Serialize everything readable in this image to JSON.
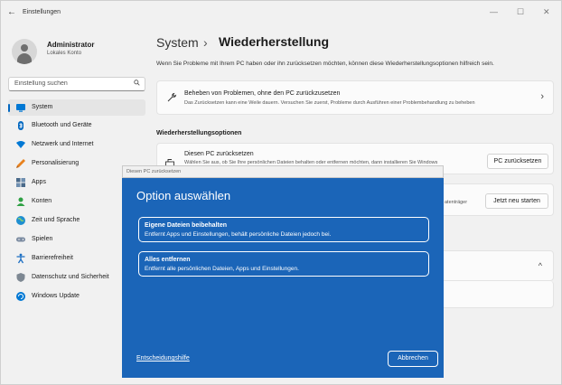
{
  "window": {
    "title": "Einstellungen",
    "back": "←",
    "min": "—",
    "max": "☐",
    "close": "✕"
  },
  "user": {
    "name": "Administrator",
    "role": "Lokales Konto"
  },
  "search": {
    "placeholder": "Einstellung suchen",
    "icon": "search-icon"
  },
  "sidebar": {
    "items": [
      {
        "label": "System",
        "icon": "system-icon",
        "color": "#0078d4"
      },
      {
        "label": "Bluetooth und Geräte",
        "icon": "bluetooth-icon",
        "color": "#0067c0"
      },
      {
        "label": "Netzwerk und Internet",
        "icon": "network-icon",
        "color": "#0078d4"
      },
      {
        "label": "Personalisierung",
        "icon": "brush-icon",
        "color": "#e8821e"
      },
      {
        "label": "Apps",
        "icon": "apps-icon",
        "color": "#4a6a8a"
      },
      {
        "label": "Konten",
        "icon": "accounts-icon",
        "color": "#2ea043"
      },
      {
        "label": "Zeit und Sprache",
        "icon": "globe-icon",
        "color": "#1f8fd0"
      },
      {
        "label": "Spielen",
        "icon": "gamepad-icon",
        "color": "#7a8aa0"
      },
      {
        "label": "Barrierefreiheit",
        "icon": "accessibility-icon",
        "color": "#1b6ec2"
      },
      {
        "label": "Datenschutz und Sicherheit",
        "icon": "shield-icon",
        "color": "#7d8792"
      },
      {
        "label": "Windows Update",
        "icon": "update-icon",
        "color": "#0078d4"
      }
    ]
  },
  "main": {
    "breadcrumb_parent": "System",
    "breadcrumb_sep": "›",
    "breadcrumb_current": "Wiederherstellung",
    "intro": "Wenn Sie Probleme mit Ihrem PC haben oder ihn zurücksetzen möchten, können diese Wiederherstellungsoptionen hilfreich sein.",
    "fix_card": {
      "title": "Beheben von Problemen, ohne den PC zurückzusetzen",
      "subtitle": "Das Zurücksetzen kann eine Weile dauern. Versuchen Sie zuerst, Probleme durch Ausführen einer Problembehandlung zu beheben",
      "chevron": "›"
    },
    "section_title": "Wiederherstellungsoptionen",
    "reset_card": {
      "title": "Diesen PC zurücksetzen",
      "subtitle": "Wählen Sie aus, ob Sie Ihre persönlichen Dateien behalten oder entfernen möchten, dann installieren Sie Windows",
      "button": "PC zurücksetzen"
    },
    "advanced_card": {
      "partial_text": "atenträger",
      "button": "Jetzt neu starten"
    },
    "collapsed_chevron": "^"
  },
  "dialog": {
    "titlebar": "Diesen PC zurücksetzen",
    "heading": "Option auswählen",
    "options": [
      {
        "title": "Eigene Dateien beibehalten",
        "subtitle": "Entfernt Apps und Einstellungen, behält persönliche Dateien jedoch bei."
      },
      {
        "title": "Alles entfernen",
        "subtitle": "Entfernt alle persönlichen Dateien, Apps und Einstellungen."
      }
    ],
    "help_link": "Entscheidungshilfe",
    "cancel": "Abbrechen",
    "color": "#1b65b8"
  }
}
